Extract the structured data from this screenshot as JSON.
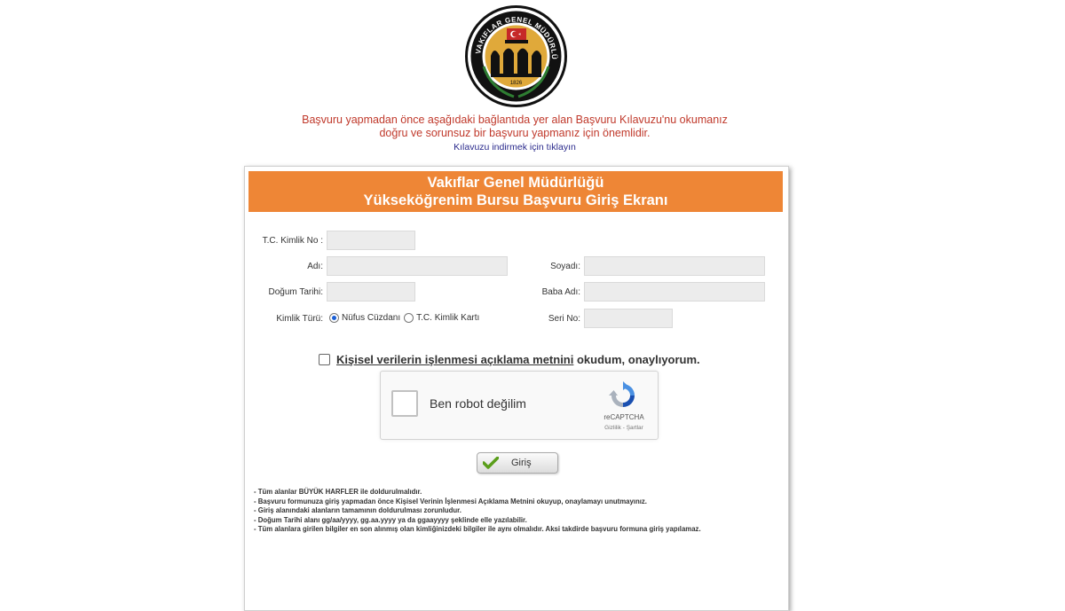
{
  "logo": {
    "ring_text": "T.C. VAKIFLAR GENEL MÜDÜRLÜĞÜ",
    "year": "1826"
  },
  "notice": {
    "line1": "Başvuru yapmadan önce aşağıdaki bağlantıda yer alan Başvuru Kılavuzu'nu okumanız",
    "line2": "doğru ve sorunsuz bir başvuru yapmanız için önemlidir.",
    "link": "Kılavuzu indirmek için tıklayın"
  },
  "header": {
    "line1": "Vakıflar Genel Müdürlüğü",
    "line2": "Yükseköğrenim Bursu Başvuru Giriş Ekranı"
  },
  "form": {
    "tc_label": "T.C. Kimlik No :",
    "tc_value": "",
    "name_label": "Adı:",
    "name_value": "",
    "surname_label": "Soyadı:",
    "surname_value": "",
    "birth_label": "Doğum Tarihi:",
    "birth_value": "",
    "father_label": "Baba Adı:",
    "father_value": "",
    "idtype_label": "Kimlik Türü:",
    "idtype_option1": "Nüfus Cüzdanı",
    "idtype_option2": "T.C. Kimlik Kartı",
    "idtype_selected": "Nüfus Cüzdanı",
    "serial_label": "Seri No:",
    "serial_value": ""
  },
  "consent": {
    "link_text": "Kişisel verilerin işlenmesi açıklama metnini",
    "rest_text": " okudum, onaylıyorum.",
    "checked": false
  },
  "captcha": {
    "label": "Ben robot değilim",
    "brand": "reCAPTCHA",
    "terms": "Gizlilik - Şartlar"
  },
  "login_label": "Giriş",
  "rules": [
    "- Tüm alanlar BÜYÜK HARFLER ile doldurulmalıdır.",
    "- Başvuru formunuza giriş yapmadan önce Kişisel Verinin İşlenmesi Açıklama Metnini okuyup, onaylamayı unutmayınız.",
    "- Giriş alanındaki alanların tamamının doldurulması zorunludur.",
    "- Doğum Tarihi alanı gg/aa/yyyy, gg.aa.yyyy ya da ggaayyyy şeklinde elle yazılabilir.",
    "- Tüm alanlara girilen bilgiler en son alınmış olan kimliğinizdeki bilgiler ile aynı olmalıdır. Aksi takdirde başvuru formuna giriş yapılamaz."
  ],
  "colors": {
    "header_bg": "#ee8636",
    "notice_red": "#c0392b",
    "link_blue": "#2a2a8c"
  }
}
